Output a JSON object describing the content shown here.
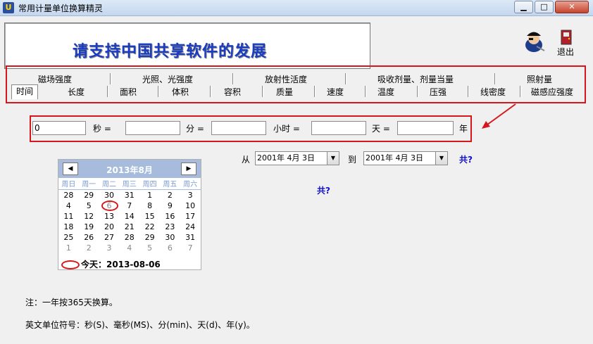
{
  "window": {
    "title": "常用计量单位换算精灵",
    "app_icon_letter": "U",
    "min_symbol": "▁",
    "max_symbol": "□",
    "close_symbol": "✕"
  },
  "banner": {
    "text": "请支持中国共享软件的发展"
  },
  "exit": {
    "label": "退出"
  },
  "tabs_row1": [
    "磁场强度",
    "光照、光强度",
    "放射性活度",
    "吸收剂量、剂量当量",
    "照射量"
  ],
  "tabs_row2": [
    "时间",
    "长度",
    "面积",
    "体积",
    "容积",
    "质量",
    "速度",
    "温度",
    "压强",
    "线密度",
    "磁感应强度"
  ],
  "converter": {
    "fields": [
      {
        "value": "0",
        "unit": "秒 ="
      },
      {
        "value": "",
        "unit": "分 ="
      },
      {
        "value": "",
        "unit": "小时 ="
      },
      {
        "value": "",
        "unit": "天 ="
      },
      {
        "value": "",
        "unit": "年"
      }
    ]
  },
  "date_range": {
    "from_label": "从",
    "from_value": "2001年 4月 3日",
    "to_label": "到",
    "to_value": "2001年 4月 3日",
    "result1": "共?",
    "result2": "共?",
    "dropdown_glyph": "▼"
  },
  "calendar": {
    "title": "2013年8月",
    "prev": "◀",
    "next": "▶",
    "weekdays": [
      "周日",
      "周一",
      "周二",
      "周三",
      "周四",
      "周五",
      "周六"
    ],
    "weeks": [
      [
        "28",
        "29",
        "30",
        "31",
        "1",
        "2",
        "3"
      ],
      [
        "4",
        "5",
        "6",
        "7",
        "8",
        "9",
        "10"
      ],
      [
        "11",
        "12",
        "13",
        "14",
        "15",
        "16",
        "17"
      ],
      [
        "18",
        "19",
        "20",
        "21",
        "22",
        "23",
        "24"
      ],
      [
        "25",
        "26",
        "27",
        "28",
        "29",
        "30",
        "31"
      ],
      [
        "1",
        "2",
        "3",
        "4",
        "5",
        "6",
        "7"
      ]
    ],
    "today_label": "今天：",
    "today_value": "2013-08-06"
  },
  "notes": {
    "note1": "注：一年按365天换算。",
    "note2": "英文单位符号：秒(S)、毫秒(MS)、分(min)、天(d)、年(y)。"
  }
}
